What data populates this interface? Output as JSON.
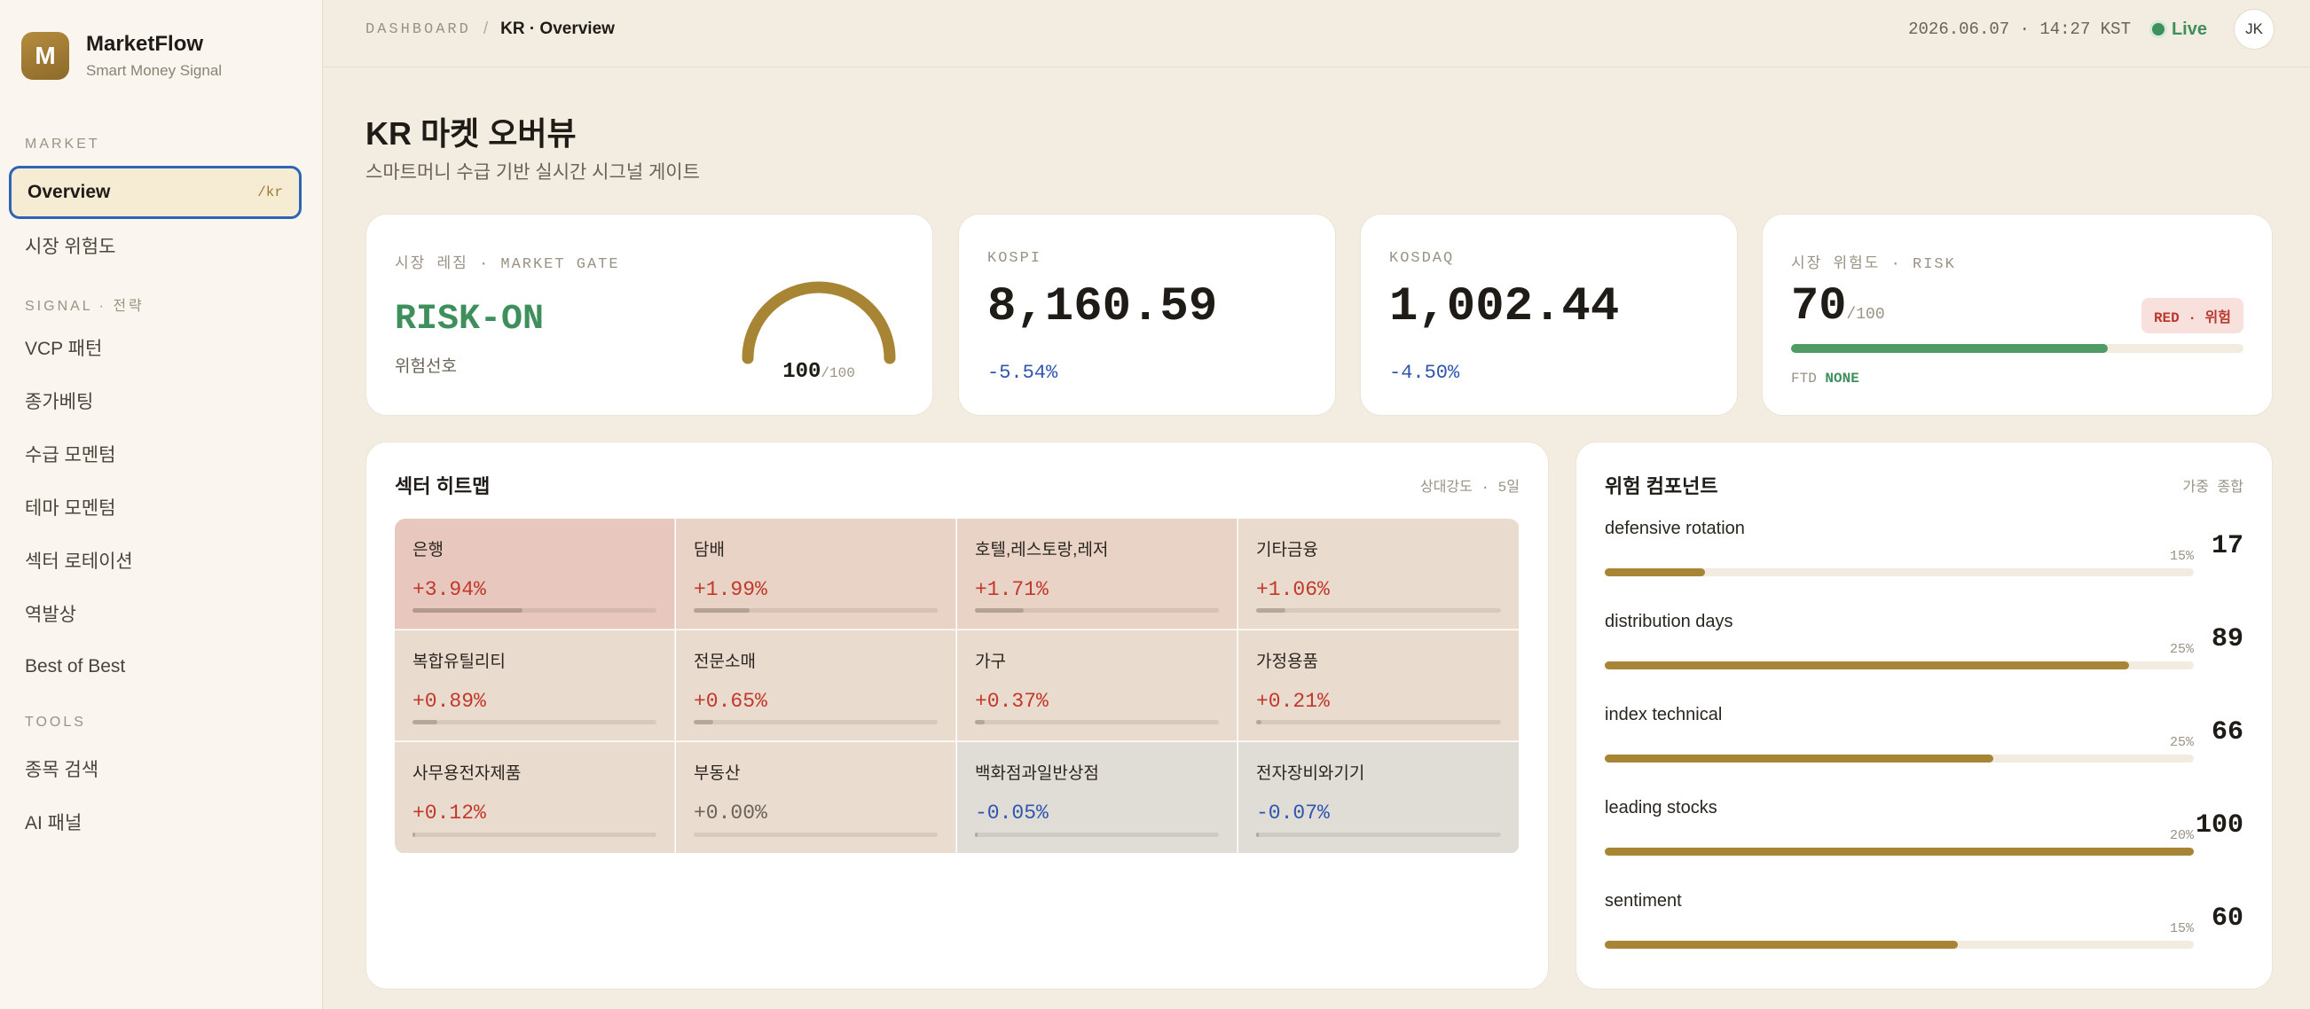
{
  "brand": {
    "logo": "M",
    "name": "MarketFlow",
    "tagline": "Smart Money Signal"
  },
  "nav": {
    "section_market": "MARKET",
    "overview": {
      "label": "Overview",
      "tag": "/kr"
    },
    "market_risk": "시장 위험도",
    "section_signal": "SIGNAL · 전략",
    "vcp": "VCP 패턴",
    "closing_bet": "종가베팅",
    "supply_momentum": "수급 모멘텀",
    "theme_momentum": "테마 모멘텀",
    "sector_rotation": "섹터 로테이션",
    "contrarian": "역발상",
    "best_of_best": "Best of Best",
    "section_tools": "TOOLS",
    "stock_search": "종목 검색",
    "ai_panel": "AI 패널"
  },
  "topbar": {
    "crumb_root": "DASHBOARD",
    "crumb_sep": "/",
    "crumb_current": "KR · Overview",
    "timestamp": "2026.06.07 · 14:27 KST",
    "live": "Live",
    "avatar": "JK"
  },
  "page": {
    "title": "KR 마켓 오버뷰",
    "subtitle": "스마트머니 수급 기반 실시간 시그널 게이트"
  },
  "gate": {
    "label": "시장 레짐 · MARKET GATE",
    "value": "RISK-ON",
    "desc": "위험선호",
    "score": "100",
    "score_max": "/100",
    "fraction": 1.0
  },
  "kospi": {
    "label": "KOSPI",
    "value": "8,160.59",
    "change": "-5.54%"
  },
  "kosdaq": {
    "label": "KOSDAQ",
    "value": "1,002.44",
    "change": "-4.50%"
  },
  "risk": {
    "label": "시장 위험도 · RISK",
    "score": "70",
    "score_max": "/100",
    "badge": "RED · 위험",
    "fraction": 0.7,
    "ftd_label": "FTD",
    "ftd_value": "NONE"
  },
  "heatmap": {
    "title": "섹터 히트맵",
    "meta": "상대강도 · 5일",
    "cells": [
      {
        "name": "은행",
        "change": "+3.94%",
        "level": 0.45,
        "tone": "up"
      },
      {
        "name": "담배",
        "change": "+1.99%",
        "level": 0.23,
        "tone": "up"
      },
      {
        "name": "호텔,레스토랑,레저",
        "change": "+1.71%",
        "level": 0.2,
        "tone": "up"
      },
      {
        "name": "기타금융",
        "change": "+1.06%",
        "level": 0.12,
        "tone": "up"
      },
      {
        "name": "복합유틸리티",
        "change": "+0.89%",
        "level": 0.1,
        "tone": "up"
      },
      {
        "name": "전문소매",
        "change": "+0.65%",
        "level": 0.08,
        "tone": "up"
      },
      {
        "name": "가구",
        "change": "+0.37%",
        "level": 0.04,
        "tone": "up"
      },
      {
        "name": "가정용품",
        "change": "+0.21%",
        "level": 0.02,
        "tone": "up"
      },
      {
        "name": "사무용전자제품",
        "change": "+0.12%",
        "level": 0.01,
        "tone": "up"
      },
      {
        "name": "부동산",
        "change": "+0.00%",
        "level": 0.0,
        "tone": "flat"
      },
      {
        "name": "백화점과일반상점",
        "change": "-0.05%",
        "level": 0.01,
        "tone": "down"
      },
      {
        "name": "전자장비와기기",
        "change": "-0.07%",
        "level": 0.01,
        "tone": "down"
      }
    ]
  },
  "components": {
    "title": "위험 컴포넌트",
    "meta": "가중 종합",
    "items": [
      {
        "name": "defensive rotation",
        "weight": "15%",
        "score": "17",
        "fraction": 0.17
      },
      {
        "name": "distribution days",
        "weight": "25%",
        "score": "89",
        "fraction": 0.89
      },
      {
        "name": "index technical",
        "weight": "25%",
        "score": "66",
        "fraction": 0.66
      },
      {
        "name": "leading stocks",
        "weight": "20%",
        "score": "100",
        "fraction": 1.0
      },
      {
        "name": "sentiment",
        "weight": "15%",
        "score": "60",
        "fraction": 0.6
      }
    ]
  },
  "colors": {
    "accent": "#a88535",
    "positive": "#3e8f5c",
    "up": "#c0392b",
    "down": "#2f55b0",
    "flat": "#6b6356"
  }
}
